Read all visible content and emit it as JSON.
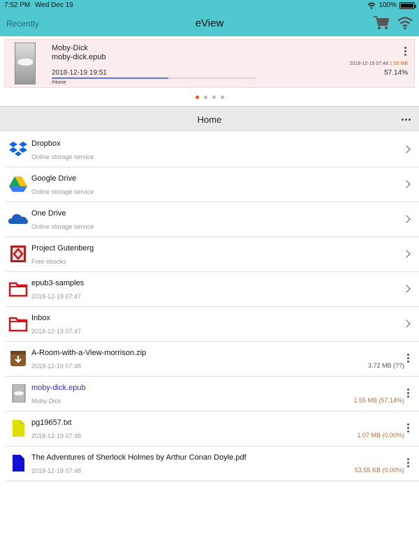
{
  "status": {
    "time": "7:52 PM",
    "date": "Wed Dec 19",
    "battery": "100%"
  },
  "nav": {
    "left": "Recently",
    "title": "eView"
  },
  "recent": {
    "title": "Moby-Dick",
    "file": "moby-dick.epub",
    "opened": "2018-12-19 19:51",
    "meta_date": "2018-12-19 07:48",
    "meta_size": "1.55 MB",
    "percent": "57.14%",
    "path": "/Home",
    "progress": 0.5714
  },
  "pager": {
    "count": 4,
    "active": 0
  },
  "section": {
    "title": "Home"
  },
  "items": [
    {
      "name": "Dropbox",
      "sub": "Online storage service",
      "size": "",
      "icon": "dropbox-icon",
      "action": "chevron"
    },
    {
      "name": "Google Drive",
      "sub": "Online storage service",
      "size": "",
      "icon": "google-drive-icon",
      "action": "chevron"
    },
    {
      "name": "One Drive",
      "sub": "Online storage service",
      "size": "",
      "icon": "onedrive-icon",
      "action": "chevron"
    },
    {
      "name": "Project Gutenberg",
      "sub": "Free ebooks",
      "size": "",
      "icon": "gutenberg-icon",
      "action": "chevron"
    },
    {
      "name": "epub3-samples",
      "sub": "2018-12-19 07:47",
      "size": "",
      "icon": "folder-icon",
      "action": "chevron"
    },
    {
      "name": "Inbox",
      "sub": "2018-12-19 07:47",
      "size": "",
      "icon": "folder-icon",
      "action": "chevron"
    },
    {
      "name": "A-Room-with-a-View-morrison.zip",
      "sub": "2018-12-19 07:48",
      "size": "3.72 MB (??)",
      "icon": "archive-icon",
      "action": "more"
    },
    {
      "name": "moby-dick.epub",
      "sub": "Moby-Dick",
      "size": "1.55 MB (57.14%)",
      "icon": "book-cover-icon",
      "action": "more"
    },
    {
      "name": "pg19657.txt",
      "sub": "2018-12-19 07:48",
      "size": "1.07 MB (0.00%)",
      "icon": "text-file-icon",
      "action": "more"
    },
    {
      "name": "The Adventures of Sherlock Holmes by Arthur Conan Doyle.pdf",
      "sub": "2018-12-19 07:48",
      "size": "53.55 KB (0.00%)",
      "icon": "pdf-file-icon",
      "action": "more"
    }
  ]
}
